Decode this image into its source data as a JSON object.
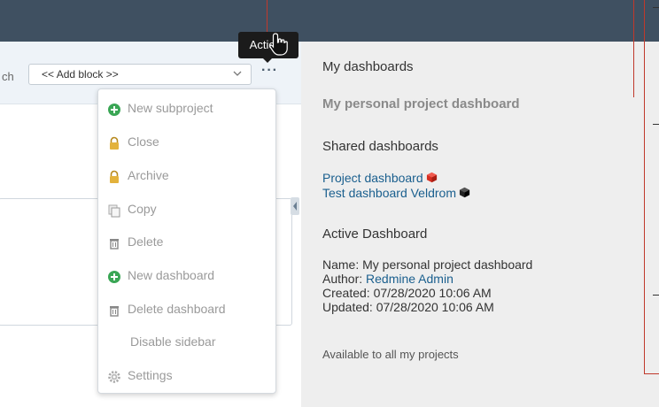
{
  "header": {
    "bg_color": "#3f5061"
  },
  "toolbar": {
    "search_label": "ch",
    "add_block_value": "<< Add block >>",
    "actions_icon": "ellipsis-icon",
    "tooltip": "Actions"
  },
  "actions_menu": {
    "items": [
      {
        "label": "New subproject",
        "icon": "plus-circle-icon"
      },
      {
        "label": "Close",
        "icon": "lock-icon"
      },
      {
        "label": "Archive",
        "icon": "lock-icon"
      },
      {
        "label": "Copy",
        "icon": "copy-icon"
      },
      {
        "label": "Delete",
        "icon": "trash-icon"
      },
      {
        "label": "New dashboard",
        "icon": "plus-circle-icon"
      },
      {
        "label": "Delete dashboard",
        "icon": "trash-icon"
      },
      {
        "label": "Disable sidebar",
        "icon": ""
      },
      {
        "label": "Settings",
        "icon": "gear-icon"
      }
    ]
  },
  "sidebar": {
    "my_dashboards_heading": "My dashboards",
    "my_personal_dashboard": "My personal project dashboard",
    "shared_heading": "Shared dashboards",
    "shared": [
      {
        "label": "Project dashboard",
        "icon": "cube-icon",
        "color": "#d62d20"
      },
      {
        "label": "Test dashboard Veldrom",
        "icon": "cube-icon",
        "color": "#222222"
      }
    ],
    "active_heading": "Active Dashboard",
    "active": {
      "name_label": "Name:",
      "name_value": "My personal project dashboard",
      "author_label": "Author:",
      "author_value": "Redmine Admin",
      "created_label": "Created:",
      "created_value": "07/28/2020 10:06 AM",
      "updated_label": "Updated:",
      "updated_value": "07/28/2020 10:06 AM"
    },
    "availability": "Available to all my projects"
  },
  "colors": {
    "sidebar_bg": "#eeeeee",
    "link": "#1a5f8e",
    "green_icon": "#3aa655",
    "lock_icon": "#e3b23c",
    "annotation_line": "#c0392b"
  }
}
